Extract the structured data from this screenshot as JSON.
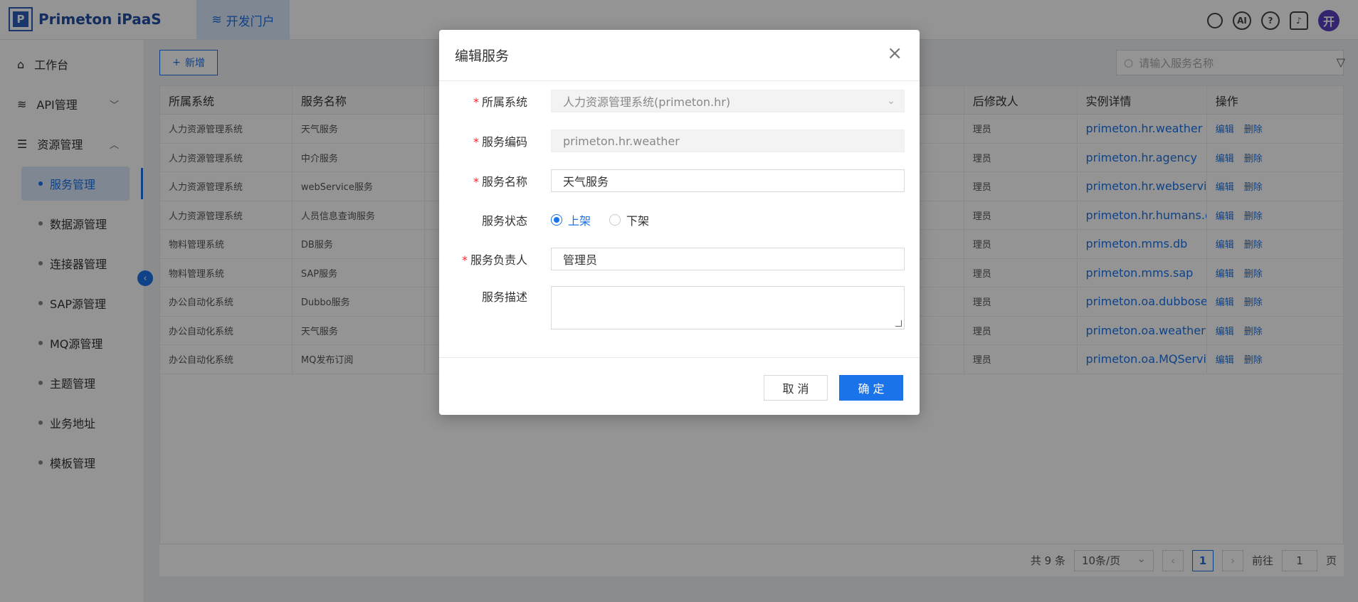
{
  "app": {
    "logo_letter": "P",
    "title": "Primeton iPaaS",
    "portal_tab": "开发门户",
    "avatar": "开"
  },
  "icons": {
    "search": "search-icon",
    "ai": "ai-icon",
    "help": "help-icon",
    "bell": "bell-icon"
  },
  "sidebar": {
    "items": [
      {
        "label": "工作台"
      },
      {
        "label": "API管理"
      },
      {
        "label": "资源管理"
      }
    ],
    "sub_items": [
      {
        "label": "服务管理"
      },
      {
        "label": "数据源管理"
      },
      {
        "label": "连接器管理"
      },
      {
        "label": "SAP源管理"
      },
      {
        "label": "MQ源管理"
      },
      {
        "label": "主题管理"
      },
      {
        "label": "业务地址"
      },
      {
        "label": "模板管理"
      }
    ]
  },
  "toolbar": {
    "add_label": "新增",
    "search_placeholder": "请输入服务名称"
  },
  "table": {
    "headers": [
      "所属系统",
      "服务名称",
      "",
      "后修改人",
      "实例详情",
      "操作"
    ],
    "rows": [
      [
        "人力资源管理系统",
        "天气服务",
        "",
        "理员",
        "primeton.hr.weather"
      ],
      [
        "人力资源管理系统",
        "中介服务",
        "",
        "理员",
        "primeton.hr.agency"
      ],
      [
        "人力资源管理系统",
        "webService服务",
        "",
        "理员",
        "primeton.hr.webservice"
      ],
      [
        "人力资源管理系统",
        "人员信息查询服务",
        "",
        "理员",
        "primeton.hr.humans.qu"
      ],
      [
        "物料管理系统",
        "DB服务",
        "",
        "理员",
        "primeton.mms.db"
      ],
      [
        "物料管理系统",
        "SAP服务",
        "",
        "理员",
        "primeton.mms.sap"
      ],
      [
        "办公自动化系统",
        "Dubbo服务",
        "",
        "理员",
        "primeton.oa.dubboserv"
      ],
      [
        "办公自动化系统",
        "天气服务",
        "",
        "理员",
        "primeton.oa.weather"
      ],
      [
        "办公自动化系统",
        "MQ发布订阅",
        "",
        "理员",
        "primeton.oa.MQService"
      ]
    ],
    "op_edit": "编辑",
    "op_delete": "删除"
  },
  "pager": {
    "total": "共 9 条",
    "page_size": "10条/页",
    "current": "1",
    "goto_label": "前往",
    "goto_value": "1",
    "page_unit": "页"
  },
  "modal": {
    "title": "编辑服务",
    "fields": {
      "system_label": "所属系统",
      "system_value": "人力资源管理系统(primeton.hr)",
      "code_label": "服务编码",
      "code_value": "primeton.hr.weather",
      "name_label": "服务名称",
      "name_value": "天气服务",
      "status_label": "服务状态",
      "status_on": "上架",
      "status_off": "下架",
      "owner_label": "服务负责人",
      "owner_value": "管理员",
      "desc_label": "服务描述",
      "desc_value": ""
    },
    "cancel_label": "取 消",
    "ok_label": "确 定"
  },
  "colors": {
    "primary": "#1a73e8",
    "required": "#f5222d"
  }
}
